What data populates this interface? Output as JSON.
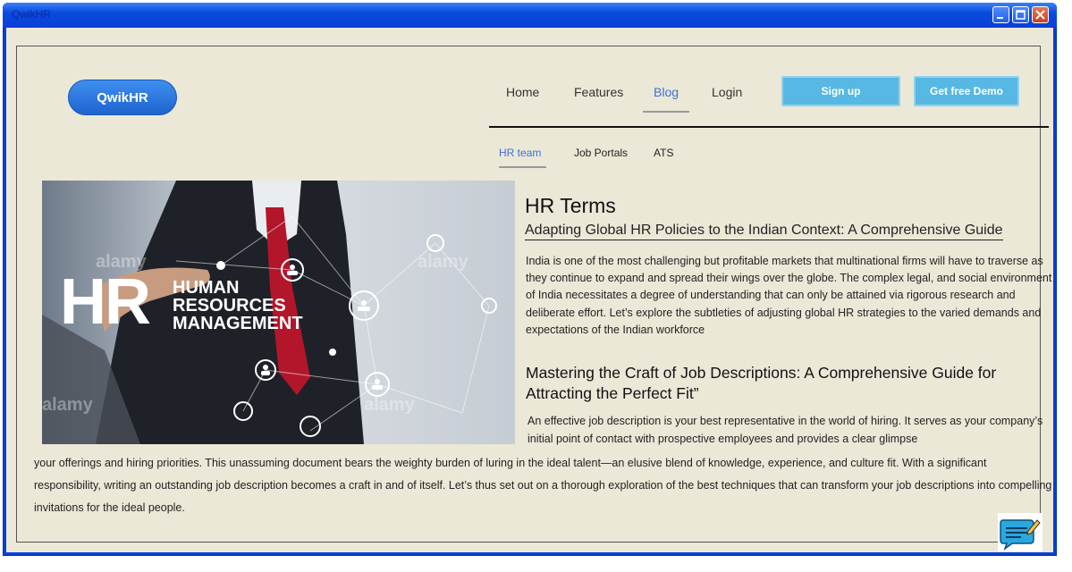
{
  "window": {
    "title": "QwikHR"
  },
  "header": {
    "logo": "QwikHR",
    "nav": [
      "Home",
      "Features",
      "Blog",
      "Login"
    ],
    "signup": "Sign up",
    "demo": "Get free Demo"
  },
  "subnav": [
    "HR team",
    "Job Portals",
    "ATS"
  ],
  "hero_image": {
    "big_text": "HR",
    "lines": [
      "HUMAN",
      "RESOURCES",
      "MANAGEMENT"
    ],
    "watermark": "alamy"
  },
  "article": {
    "heading": "HR Terms",
    "post1_title": "Adapting Global HR Policies to the Indian Context: A Comprehensive Guide",
    "post1_body": "India is one of the most challenging but profitable markets that multinational firms will have to traverse as they continue to expand and spread their wings over the globe. The complex legal, and social environment of India necessitates a degree of understanding that can only be attained via rigorous research and deliberate effort. Let’s explore the subtleties of adjusting global HR strategies to the varied demands and expectations of the Indian workforce",
    "post2_title": "Mastering the Craft of Job Descriptions: A Comprehensive Guide for Attracting the Perfect Fit”",
    "post2_body_a": "An effective job description is your best representative in the world of hiring. It serves as your company’s initial point of contact with prospective employees and provides a clear glimpse",
    "post2_body_b": "your offerings and hiring priorities. This unassuming document bears the weighty burden of luring in the ideal talent—an elusive blend of knowledge, experience, and culture fit. With a significant responsibility, writing an outstanding job description becomes a craft in and of itself. Let’s thus set out on a thorough exploration of the best techniques that can transform your job descriptions into compelling invitations for the ideal people."
  },
  "icons": {
    "chat": "chat-edit-icon",
    "minimize": "minimize-icon",
    "maximize": "maximize-icon",
    "close": "close-icon"
  },
  "colors": {
    "window_blue": "#0a3fd6",
    "background": "#ebe8d7",
    "accent_button": "#56b8e3",
    "link_active": "#3f6fd6"
  }
}
